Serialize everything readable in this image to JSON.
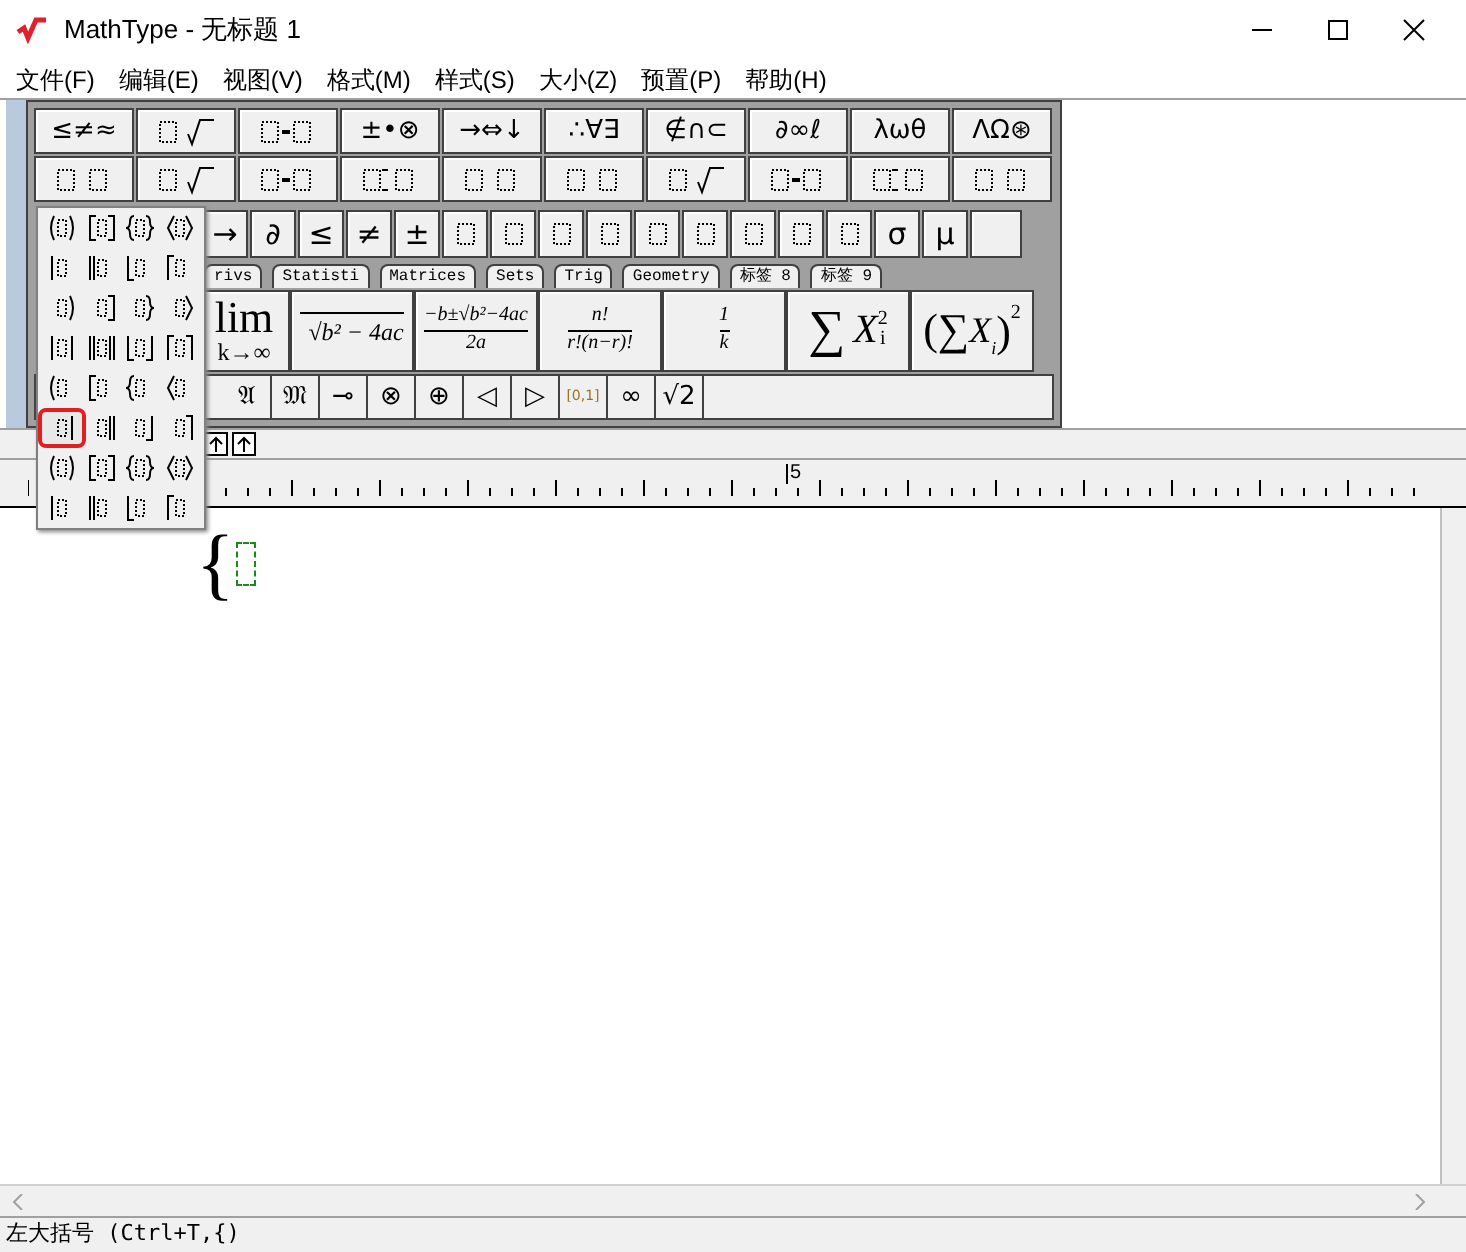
{
  "window": {
    "title": "MathType - 无标题 1"
  },
  "menu": [
    "文件(F)",
    "编辑(E)",
    "视图(V)",
    "格式(M)",
    "样式(S)",
    "大小(Z)",
    "预置(P)",
    "帮助(H)"
  ],
  "palette_row_1": [
    {
      "kind": "text",
      "label": "≤≠≈"
    },
    {
      "kind": "icon"
    },
    {
      "kind": "icon"
    },
    {
      "kind": "text",
      "label": "±•⊗"
    },
    {
      "kind": "text",
      "label": "→⇔↓"
    },
    {
      "kind": "text",
      "label": "∴∀∃"
    },
    {
      "kind": "text",
      "label": "∉∩⊂"
    },
    {
      "kind": "text",
      "label": "∂∞ℓ"
    },
    {
      "kind": "text",
      "label": "λωθ"
    },
    {
      "kind": "text",
      "label": "ΛΩ⊛"
    }
  ],
  "palette_row_2": [
    {
      "kind": "icon"
    },
    {
      "kind": "icon"
    },
    {
      "kind": "icon"
    },
    {
      "kind": "icon"
    },
    {
      "kind": "icon"
    },
    {
      "kind": "icon"
    },
    {
      "kind": "icon"
    },
    {
      "kind": "icon"
    },
    {
      "kind": "icon"
    },
    {
      "kind": "icon"
    }
  ],
  "small_bar": [
    {
      "kind": "text",
      "label": "→"
    },
    {
      "kind": "text",
      "label": "∂"
    },
    {
      "kind": "text",
      "label": "≤"
    },
    {
      "kind": "text",
      "label": "≠"
    },
    {
      "kind": "text",
      "label": "±"
    },
    {
      "kind": "icon"
    },
    {
      "kind": "icon"
    },
    {
      "kind": "icon"
    },
    {
      "kind": "icon"
    },
    {
      "kind": "icon"
    },
    {
      "kind": "icon"
    },
    {
      "kind": "icon"
    },
    {
      "kind": "icon"
    },
    {
      "kind": "icon"
    },
    {
      "kind": "text",
      "label": "σ"
    },
    {
      "kind": "text",
      "label": "μ"
    },
    {
      "kind": "empty"
    }
  ],
  "tabs": [
    {
      "label": "rivs",
      "selected": false
    },
    {
      "label": "Statisti",
      "selected": false
    },
    {
      "label": "Matrices",
      "selected": false
    },
    {
      "label": "Sets",
      "selected": false
    },
    {
      "label": "Trig",
      "selected": false
    },
    {
      "label": "Geometry",
      "selected": false
    },
    {
      "label": "标签 8",
      "selected": false
    },
    {
      "label": "标签 9",
      "selected": false
    }
  ],
  "templates": [
    {
      "kind": "lim",
      "top": "lim",
      "bottom": "k→∞"
    },
    {
      "kind": "sqrt",
      "radical": "√",
      "body": "b² − 4ac"
    },
    {
      "kind": "frac",
      "num": "−b±√b²−4ac",
      "den": "2a"
    },
    {
      "kind": "frac",
      "num": "n!",
      "den": "r!(n−r)!"
    },
    {
      "kind": "frac",
      "num": "1",
      "den": "k"
    },
    {
      "kind": "sum",
      "symbol": "∑",
      "base": "X",
      "sub": "i",
      "sup": "2"
    },
    {
      "kind": "sumparen",
      "symbol": "(∑",
      "base": "X",
      "sub": "i",
      "close": ")",
      "sup": "2"
    }
  ],
  "symbol_bar": [
    "𝔄",
    "𝔐",
    "⊸",
    "⊗",
    "⊕",
    "◁",
    "▷",
    "[0,1]",
    "∞",
    "√2"
  ],
  "bracket_menu": [
    {
      "selected": false
    },
    {
      "selected": false
    },
    {
      "selected": false
    },
    {
      "selected": false
    },
    {
      "selected": false
    },
    {
      "selected": false
    },
    {
      "selected": false
    },
    {
      "selected": false
    },
    {
      "selected": false
    },
    {
      "selected": false
    },
    {
      "selected": false
    },
    {
      "selected": false
    },
    {
      "selected": false
    },
    {
      "selected": false
    },
    {
      "selected": false
    },
    {
      "selected": false
    },
    {
      "selected": false
    },
    {
      "selected": false
    },
    {
      "selected": false
    },
    {
      "selected": false
    },
    {
      "selected": true
    },
    {
      "selected": false
    },
    {
      "selected": false
    },
    {
      "selected": false
    },
    {
      "selected": false
    },
    {
      "selected": false
    },
    {
      "selected": false
    },
    {
      "selected": false
    },
    {
      "selected": false
    },
    {
      "selected": false
    },
    {
      "selected": false
    },
    {
      "selected": false
    }
  ],
  "ruler": {
    "mark": "5"
  },
  "editor": {
    "brace": "{"
  },
  "status_bar": "左大括号 (Ctrl+T,{)"
}
